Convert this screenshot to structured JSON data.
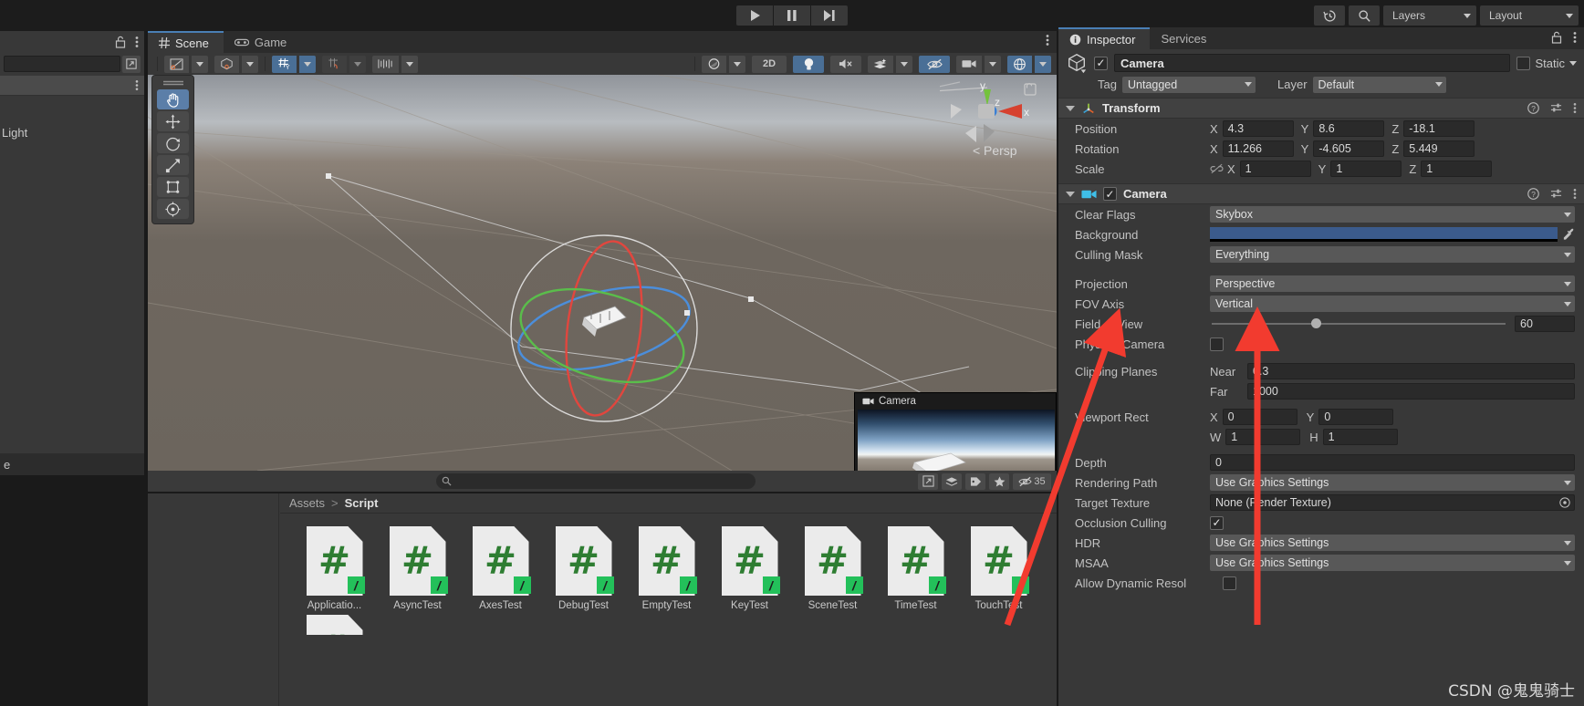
{
  "topbar": {
    "play_icon": "play-icon",
    "pause_icon": "pause-icon",
    "step_icon": "step-icon",
    "history_icon": "history-icon",
    "search_icon": "search-icon",
    "layers_label": "Layers",
    "layout_label": "Layout"
  },
  "hierarchy": {
    "lock_icon": "lock-icon",
    "menu_icon": "kebab-menu-icon",
    "search_placeholder": "",
    "scene_row_label": "",
    "items": [
      {
        "label": "Light"
      }
    ],
    "footer_label": "e"
  },
  "scene": {
    "tabs": [
      {
        "label": "Scene",
        "icon": "grid-icon",
        "active": true
      },
      {
        "label": "Game",
        "icon": "gamepad-icon",
        "active": false
      }
    ],
    "menu_icon": "kebab-menu-icon",
    "toolbar": {
      "draw_mode": "shaded-icon",
      "gizmo_mode": "cube-icon",
      "grid_axis": "grid-y-icon",
      "snap": "snap-icon",
      "grid_size": "ruler-icon",
      "lighting_sphere": "sphere-icon",
      "two_d_label": "2D",
      "light_icon": "lightbulb-icon",
      "audio_icon": "mute-icon",
      "fx_icon": "effects-icon",
      "visibility_icon": "eye-off-icon",
      "camera_icon": "camera-icon",
      "gizmos_icon": "globe-icon"
    },
    "gizmo": {
      "persp_label": "Persp",
      "axis_y": "y",
      "axis_z": "z",
      "axis_x": "x",
      "lock_icon": "lock-icon"
    },
    "footer": {
      "search_icon": "search-icon",
      "search_value": "",
      "pick_icon": "target-icon",
      "layers_icon": "layers-icon",
      "tag_icon": "tag-icon",
      "star_icon": "star-icon",
      "hidden_icon": "eye-slash-icon",
      "hidden_count": "35"
    }
  },
  "camera_preview": {
    "title": "Camera"
  },
  "project": {
    "breadcrumb": [
      {
        "label": "Assets",
        "current": false
      },
      {
        "label": "Script",
        "current": true
      }
    ],
    "separator": ">",
    "assets": [
      {
        "name": "Applicatio...",
        "type": "csharp-script"
      },
      {
        "name": "AsyncTest",
        "type": "csharp-script"
      },
      {
        "name": "AxesTest",
        "type": "csharp-script"
      },
      {
        "name": "DebugTest",
        "type": "csharp-script"
      },
      {
        "name": "EmptyTest",
        "type": "csharp-script"
      },
      {
        "name": "KeyTest",
        "type": "csharp-script"
      },
      {
        "name": "SceneTest",
        "type": "csharp-script"
      },
      {
        "name": "TimeTest",
        "type": "csharp-script"
      },
      {
        "name": "TouchTest",
        "type": "csharp-script"
      }
    ],
    "hash_glyph": "#"
  },
  "inspector": {
    "tabs": [
      {
        "label": "Inspector",
        "active": true,
        "icon": "info-icon"
      },
      {
        "label": "Services",
        "active": false,
        "icon": ""
      }
    ],
    "lock_icon": "lock-icon",
    "menu_icon": "kebab-menu-icon",
    "object": {
      "icon": "cube-icon",
      "enabled": true,
      "name": "Camera",
      "static_label": "Static",
      "tag_label": "Tag",
      "tag_value": "Untagged",
      "layer_label": "Layer",
      "layer_value": "Default"
    },
    "transform": {
      "title": "Transform",
      "icon": "transform-icon",
      "help_icon": "help-icon",
      "preset_icon": "preset-icon",
      "menu_icon": "kebab-menu-icon",
      "rows": [
        {
          "name": "Position",
          "x": "4.3",
          "y": "8.6",
          "z": "-18.1",
          "link": false
        },
        {
          "name": "Rotation",
          "x": "11.266",
          "y": "-4.605",
          "z": "5.449",
          "link": false
        },
        {
          "name": "Scale",
          "x": "1",
          "y": "1",
          "z": "1",
          "link": true,
          "link_icon": "link-broken-icon"
        }
      ],
      "axis_labels": {
        "x": "X",
        "y": "Y",
        "z": "Z"
      }
    },
    "camera": {
      "title": "Camera",
      "icon": "camera-icon",
      "enabled": true,
      "help_icon": "help-icon",
      "preset_icon": "preset-icon",
      "menu_icon": "kebab-menu-icon",
      "clear_flags_label": "Clear Flags",
      "clear_flags_value": "Skybox",
      "background_label": "Background",
      "background_color": "#3b5b8c",
      "eyedropper_icon": "eyedropper-icon",
      "culling_mask_label": "Culling Mask",
      "culling_mask_value": "Everything",
      "projection_label": "Projection",
      "projection_value": "Perspective",
      "fov_axis_label": "FOV Axis",
      "fov_axis_value": "Vertical",
      "field_of_view_label": "Field of View",
      "field_of_view_value": "60",
      "physical_camera_label": "Physical Camera",
      "physical_camera_checked": false,
      "clipping_planes_label": "Clipping Planes",
      "near_label": "Near",
      "near_value": "0.3",
      "far_label": "Far",
      "far_value": "1000",
      "viewport_rect_label": "Viewport Rect",
      "viewport_x_label": "X",
      "viewport_x": "0",
      "viewport_y_label": "Y",
      "viewport_y": "0",
      "viewport_w_label": "W",
      "viewport_w": "1",
      "viewport_h_label": "H",
      "viewport_h": "1",
      "depth_label": "Depth",
      "depth_value": "0",
      "rendering_path_label": "Rendering Path",
      "rendering_path_value": "Use Graphics Settings",
      "target_texture_label": "Target Texture",
      "target_texture_value": "None (Render Texture)",
      "object_picker_icon": "circle-dot-icon",
      "occlusion_culling_label": "Occlusion Culling",
      "occlusion_culling_checked": true,
      "hdr_label": "HDR",
      "hdr_value": "Use Graphics Settings",
      "msaa_label": "MSAA",
      "msaa_value": "Use Graphics Settings",
      "allow_dynamic_label": "Allow Dynamic Resol",
      "allow_dynamic_checked": false
    }
  },
  "watermark": "CSDN @鬼鬼骑士",
  "annotations": {
    "arrow_color": "#f23b2f",
    "arrow_1_target": "fov-axis-label",
    "arrow_2_target": "fov-axis-dropdown"
  }
}
